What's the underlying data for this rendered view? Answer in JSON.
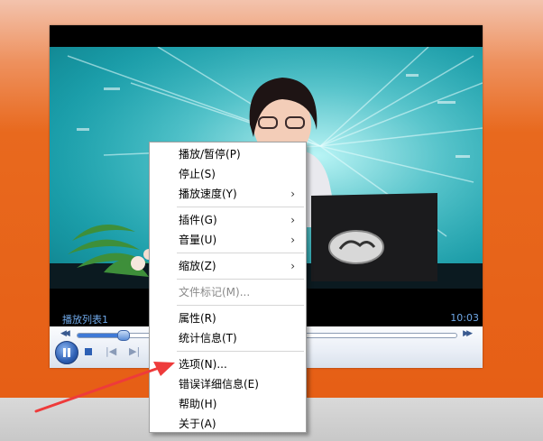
{
  "player": {
    "playlist_label": "播放列表1",
    "time": "10:03"
  },
  "context_menu": {
    "items": [
      {
        "label": "播放/暂停(P)",
        "submenu": false,
        "disabled": false
      },
      {
        "label": "停止(S)",
        "submenu": false,
        "disabled": false
      },
      {
        "label": "播放速度(Y)",
        "submenu": true,
        "disabled": false
      },
      {
        "label": "插件(G)",
        "submenu": true,
        "disabled": false
      },
      {
        "label": "音量(U)",
        "submenu": true,
        "disabled": false
      },
      {
        "label": "缩放(Z)",
        "submenu": true,
        "disabled": false
      },
      {
        "label": "文件标记(M)...",
        "submenu": false,
        "disabled": true
      },
      {
        "label": "属性(R)",
        "submenu": false,
        "disabled": false
      },
      {
        "label": "统计信息(T)",
        "submenu": false,
        "disabled": false
      },
      {
        "label": "选项(N)...",
        "submenu": false,
        "disabled": false
      },
      {
        "label": "错误详细信息(E)",
        "submenu": false,
        "disabled": false
      },
      {
        "label": "帮助(H)",
        "submenu": false,
        "disabled": false
      },
      {
        "label": "关于(A)",
        "submenu": false,
        "disabled": false
      }
    ],
    "submenu_glyph": "›"
  },
  "colors": {
    "annotation_arrow": "#ee3b3b",
    "seek_fill": "#3f79d6"
  },
  "seek_progress": 0.12
}
